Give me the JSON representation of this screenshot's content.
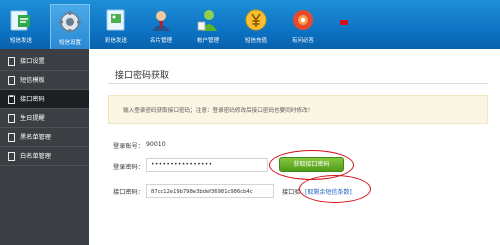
{
  "toolbar": {
    "items": [
      {
        "label": "短信发送",
        "icon": "message-send-icon"
      },
      {
        "label": "短信设置",
        "icon": "gear-settings-icon"
      },
      {
        "label": "彩信发送",
        "icon": "mms-send-icon"
      },
      {
        "label": "名片管理",
        "icon": "business-card-icon"
      },
      {
        "label": "帐户管理",
        "icon": "account-icon"
      },
      {
        "label": "短信充值",
        "icon": "yen-recharge-icon"
      },
      {
        "label": "有问必答",
        "icon": "question-answer-icon"
      }
    ],
    "active_index": 1
  },
  "sidebar": {
    "items": [
      {
        "label": "接口设置",
        "icon": "doc-icon"
      },
      {
        "label": "短信模板",
        "icon": "doc-icon"
      },
      {
        "label": "接口密码",
        "icon": "clipboard-icon"
      },
      {
        "label": "生日提醒",
        "icon": "doc-icon"
      },
      {
        "label": "黑名单管理",
        "icon": "doc-icon"
      },
      {
        "label": "白名单管理",
        "icon": "doc-icon"
      }
    ],
    "active_index": 2
  },
  "main": {
    "title": "接口密码获取",
    "notice": "输入登录密码获取接口密码；注意：登录密码修改后接口密码也要同时修改！",
    "account_label": "登录账号：",
    "account_value": "90010",
    "password_label": "登录密码：",
    "password_value": "••••••••••••••••",
    "get_password_button": "获取接口密码",
    "api_password_label": "接口密码：",
    "api_password_value": "87cc12e19b798e3bdef36981c986cb4c",
    "api_check_label": "接口验",
    "remaining_link": "[取剩余短信条数]"
  },
  "colors": {
    "toolbar_blue": "#0b6fc0",
    "sidebar_dark": "#3b3f43",
    "button_green": "#5fa626",
    "annotation_red": "#d3101a",
    "link_blue": "#1a5fc8"
  }
}
